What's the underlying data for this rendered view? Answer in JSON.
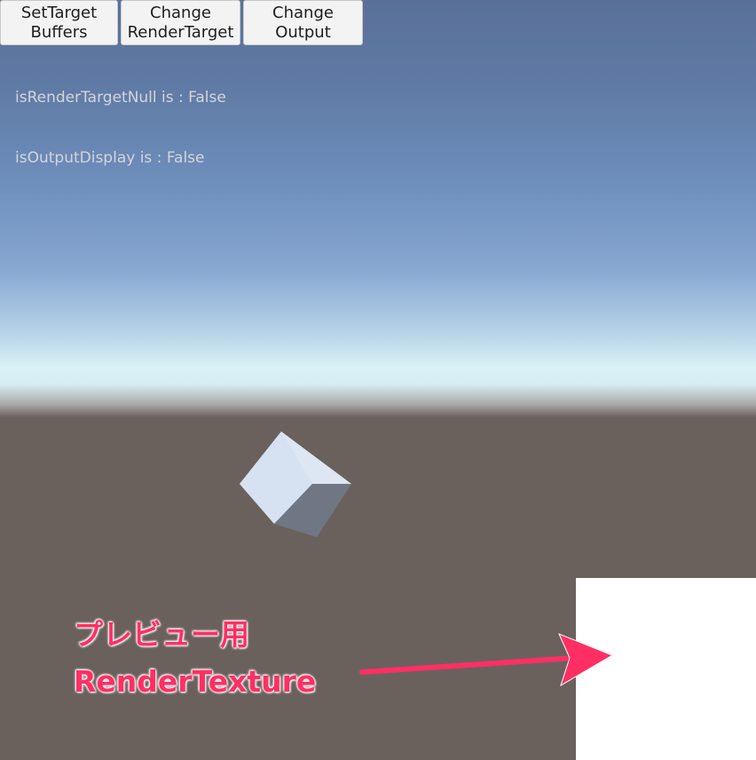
{
  "toolbar": {
    "buttons": [
      {
        "line1": "SetTarget",
        "line2": "Buffers"
      },
      {
        "line1": "Change",
        "line2": "RenderTarget"
      },
      {
        "line1": "Change",
        "line2": "Output"
      }
    ]
  },
  "status": {
    "render_target_null": "isRenderTargetNull is : False",
    "output_display": "isOutputDisplay is : False"
  },
  "annotation": {
    "line1": "プレビュー用",
    "line2": "RenderTexture",
    "color": "#ff2f63"
  },
  "colors": {
    "ground": "#6a615d",
    "sky_top": "#5a7099",
    "horizon": "#d8f2f6",
    "preview_panel": "#ffffff"
  }
}
